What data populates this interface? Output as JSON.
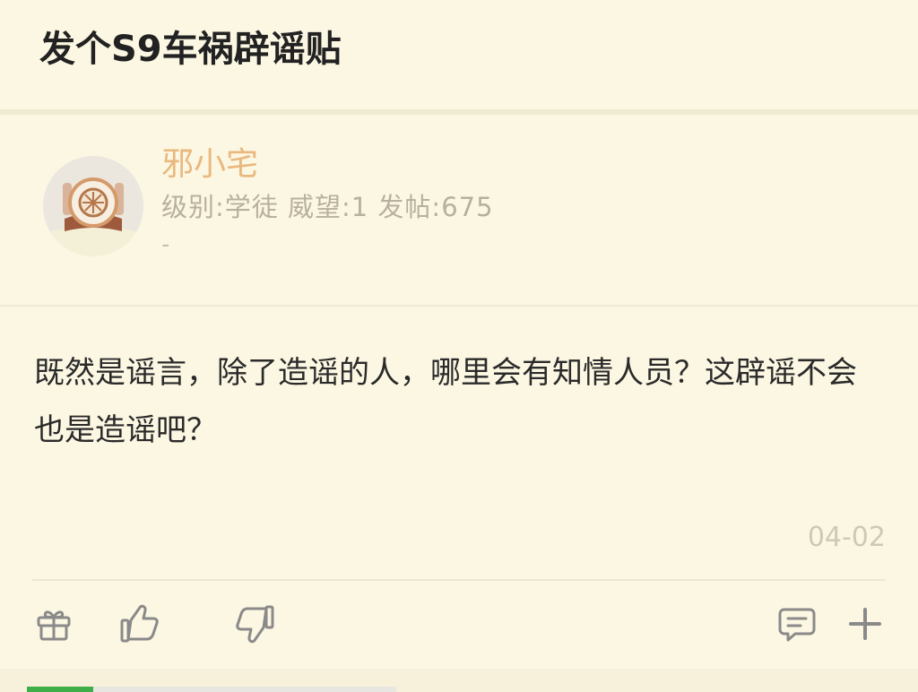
{
  "thread": {
    "title": "发个S9车祸辟谣贴"
  },
  "author": {
    "name": "邪小宅",
    "meta": "级别:学徒 威望:1 发帖:675",
    "signature": "-"
  },
  "post": {
    "content": "既然是谣言，除了造谣的人，哪里会有知情人员？这辟谣不会也是造谣吧？",
    "date": "04-02"
  },
  "actions": {
    "icons": [
      "gift-icon",
      "thumbs-up-icon",
      "thumbs-down-icon",
      "comment-icon",
      "plus-icon"
    ]
  },
  "colors": {
    "background": "#fcf7e3",
    "username": "#e9b87d",
    "meta": "#b8b09f",
    "icon": "#8a8a8a"
  }
}
